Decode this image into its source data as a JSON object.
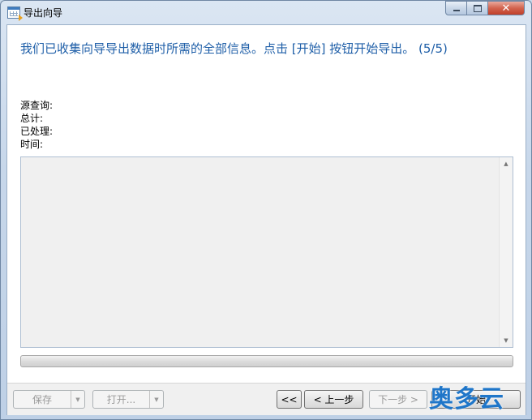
{
  "window": {
    "title": "导出向导",
    "controls": {
      "minimize": "—",
      "maximize": "☐",
      "close": "✕"
    }
  },
  "main": {
    "heading": "我们已收集向导导出数据时所需的全部信息。点击 [开始] 按钮开始导出。 (5/5)",
    "info": {
      "source_query_label": "源查询:",
      "total_label": "总计:",
      "processed_label": "已处理:",
      "time_label": "时间:"
    },
    "log_text": "",
    "progress": 0
  },
  "footer": {
    "save_label": "保存",
    "open_label": "打开...",
    "first_label": "<<",
    "prev_label": "< 上一步",
    "next_label": "下一步 >",
    "start_label": "开始"
  },
  "icons": {
    "app": "export-wizard-icon",
    "scroll_up": "scroll-up-icon",
    "scroll_down": "scroll-down-icon",
    "dropdown": "chevron-down-icon"
  },
  "watermark": "奥多云",
  "colors": {
    "heading": "#1f5fa8",
    "close_button": "#c0402a",
    "watermark": "#1f76c9"
  }
}
